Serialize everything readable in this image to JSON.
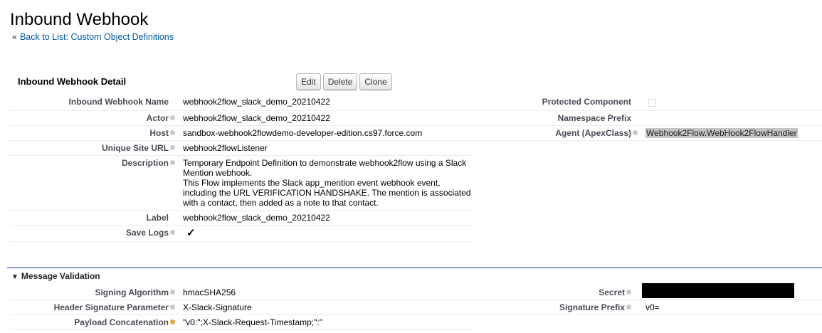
{
  "page": {
    "title": "Inbound Webhook",
    "back_guillemet": "«",
    "back_link": "Back to List: Custom Object Definitions"
  },
  "detail": {
    "section_title": "Inbound Webhook Detail",
    "buttons": {
      "edit": "Edit",
      "delete": "Delete",
      "clone": "Clone"
    },
    "left_fields": [
      {
        "label": "Inbound Webhook Name",
        "value": "webhook2flow_slack_demo_20210422"
      },
      {
        "label": "Actor",
        "value": "webhook2flow_slack_demo_20210422"
      },
      {
        "label": "Host",
        "value": "sandbox-webhook2flowdemo-developer-edition.cs97.force.com"
      },
      {
        "label": "Unique Site URL",
        "value": "webhook2flowListener"
      },
      {
        "label": "Description",
        "value": "Temporary Endpoint Definition to demonstrate webhook2flow using a Slack Mention webhook.\nThis Flow implements the Slack app_mention event webhook event, including the URL VERIFICATION HANDSHAKE. The mention is associated with a contact, then added as a note to that contact."
      },
      {
        "label": "Label",
        "value": "webhook2flow_slack_demo_20210422"
      },
      {
        "label": "Save Logs",
        "value": "✓"
      }
    ],
    "right_fields": [
      {
        "label": "Protected Component",
        "value": ""
      },
      {
        "label": "Namespace Prefix",
        "value": ""
      },
      {
        "label": "Agent (ApexClass)",
        "value": "Webhook2Flow.WebHook2FlowHandler"
      }
    ]
  },
  "message_validation": {
    "header": "Message Validation",
    "toggle_icon": "▼",
    "left_fields": [
      {
        "label": "Signing Algorithm",
        "value": "hmacSHA256"
      },
      {
        "label": "Header Signature Parameter",
        "value": "X-Slack-Signature"
      },
      {
        "label": "Payload Concatenation",
        "value": "\"v0:\";X-Slack-Request-Timestamp;\":\""
      }
    ],
    "right_fields": [
      {
        "label": "Secret",
        "value": ""
      },
      {
        "label": "Signature Prefix",
        "value": "v0="
      }
    ]
  },
  "colors": {
    "link": "#015ba7",
    "label": "#4a4a56",
    "separator": "#8e9dbe",
    "help_icon": "#c9c9c9",
    "help_icon_warning": "#f2a23a"
  }
}
